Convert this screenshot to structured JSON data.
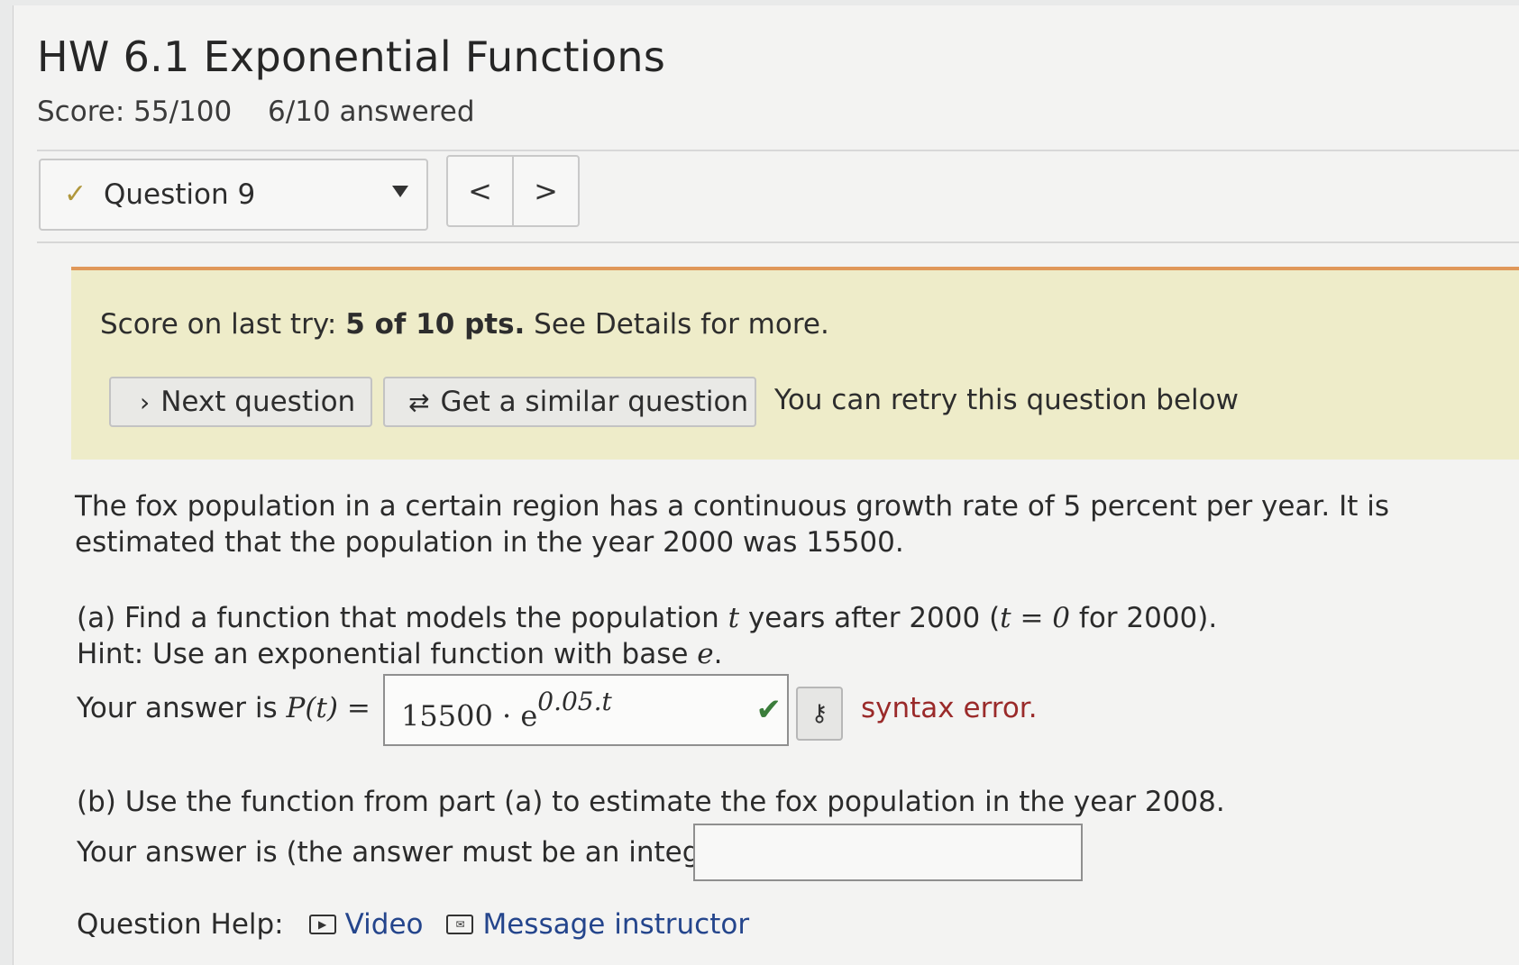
{
  "header": {
    "title": "HW 6.1 Exponential Functions",
    "score": "Score: 55/100",
    "answered": "6/10 answered"
  },
  "question_nav": {
    "selected": "Question 9",
    "prev_symbol": "<",
    "next_symbol": ">"
  },
  "banner": {
    "prefix": "Score on last try: ",
    "score_bold": "5 of 10 pts.",
    "suffix": " See Details for more.",
    "next_label": "Next question",
    "similar_label": "Get a similar question",
    "retry_text": "You can retry this question below"
  },
  "problem": {
    "statement": "The fox population in a certain region has a continuous growth rate of 5 percent per year. It is estimated that the population in the year 2000 was 15500.",
    "part_a_1": "(a) Find a function that models the population ",
    "part_a_var": "t",
    "part_a_2": " years after 2000 (",
    "part_a_eq": "t = 0",
    "part_a_3": " for 2000).",
    "hint_1": "Hint: Use an exponential function with base ",
    "hint_var": "e",
    "hint_2": ".",
    "answer_a_label": "Your answer is ",
    "answer_a_func": "P(t) =",
    "answer_a_base": "15500 · e",
    "answer_a_exp": "0.05.t",
    "answer_a_status": "syntax error.",
    "part_b": "(b) Use the function from part (a) to estimate the fox population in the year 2008.",
    "answer_b_label": "Your answer is (the answer must be an integer)",
    "answer_b_value": ""
  },
  "help": {
    "label": "Question Help:",
    "video": "Video",
    "message": "Message instructor"
  },
  "colors": {
    "banner_bg": "#eeecc9",
    "banner_border": "#e0985a",
    "error_text": "#9a2a2a",
    "link": "#24458c",
    "check": "#3b7d3b"
  }
}
